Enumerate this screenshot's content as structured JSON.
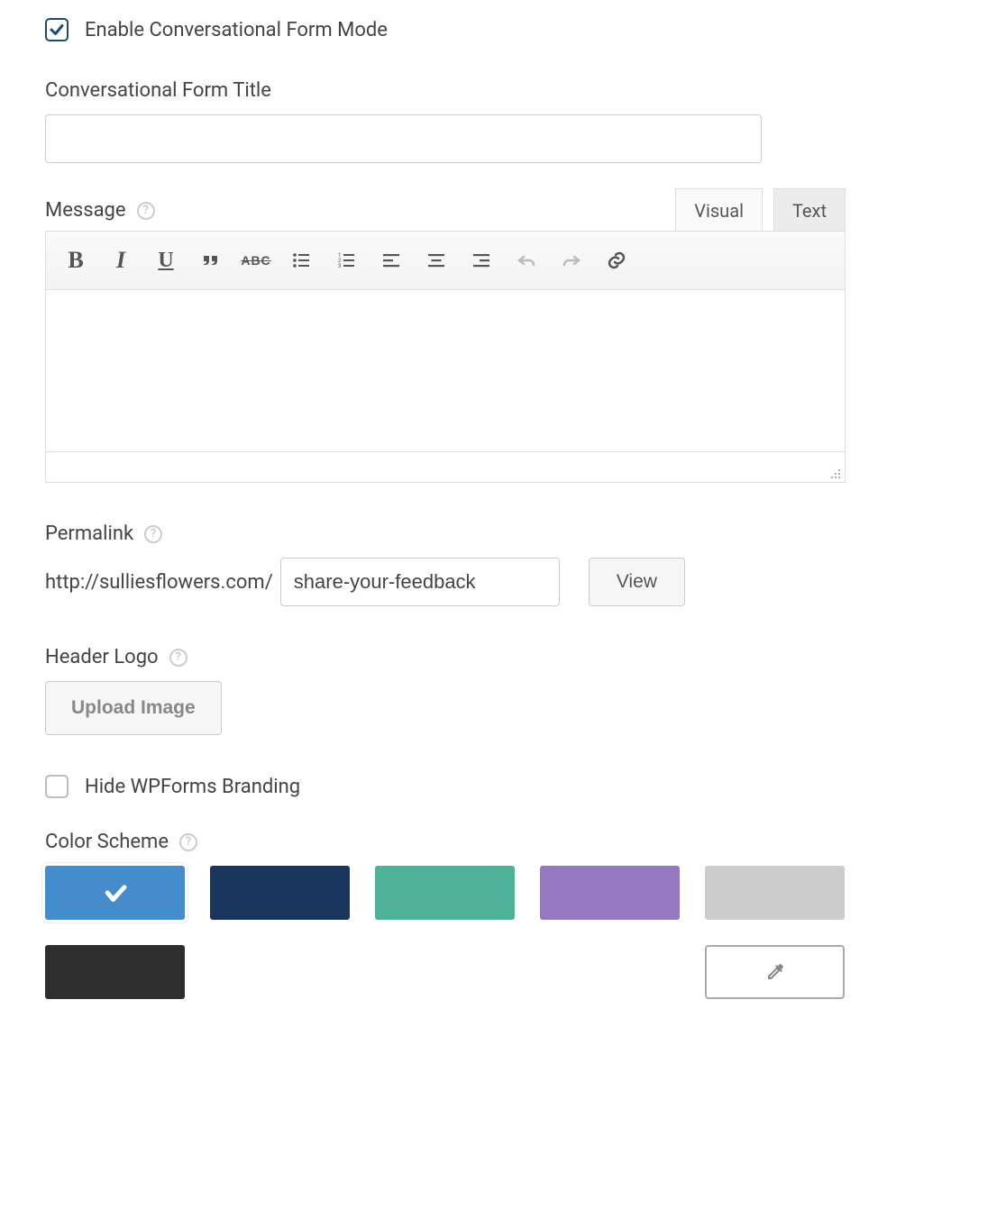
{
  "enable": {
    "label": "Enable Conversational Form Mode",
    "checked": true
  },
  "title": {
    "label": "Conversational Form Title",
    "value": ""
  },
  "message": {
    "label": "Message",
    "tab_visual": "Visual",
    "tab_text": "Text",
    "value": ""
  },
  "toolbar": {
    "bold": "B",
    "italic": "I",
    "underline": "U",
    "strike": "ABC"
  },
  "permalink": {
    "label": "Permalink",
    "base": "http://sulliesflowers.com/",
    "slug": "share-your-feedback",
    "view": "View"
  },
  "headerlogo": {
    "label": "Header Logo",
    "button": "Upload Image"
  },
  "hide_branding": {
    "label": "Hide WPForms Branding",
    "checked": false
  },
  "color_scheme": {
    "label": "Color Scheme",
    "swatches": [
      {
        "hex": "#448ccb",
        "selected": true
      },
      {
        "hex": "#1a365d",
        "selected": false
      },
      {
        "hex": "#4fb39a",
        "selected": false
      },
      {
        "hex": "#9579c0",
        "selected": false
      },
      {
        "hex": "#cccccc",
        "selected": false
      },
      {
        "hex": "#2e2e2e",
        "selected": false
      }
    ]
  }
}
